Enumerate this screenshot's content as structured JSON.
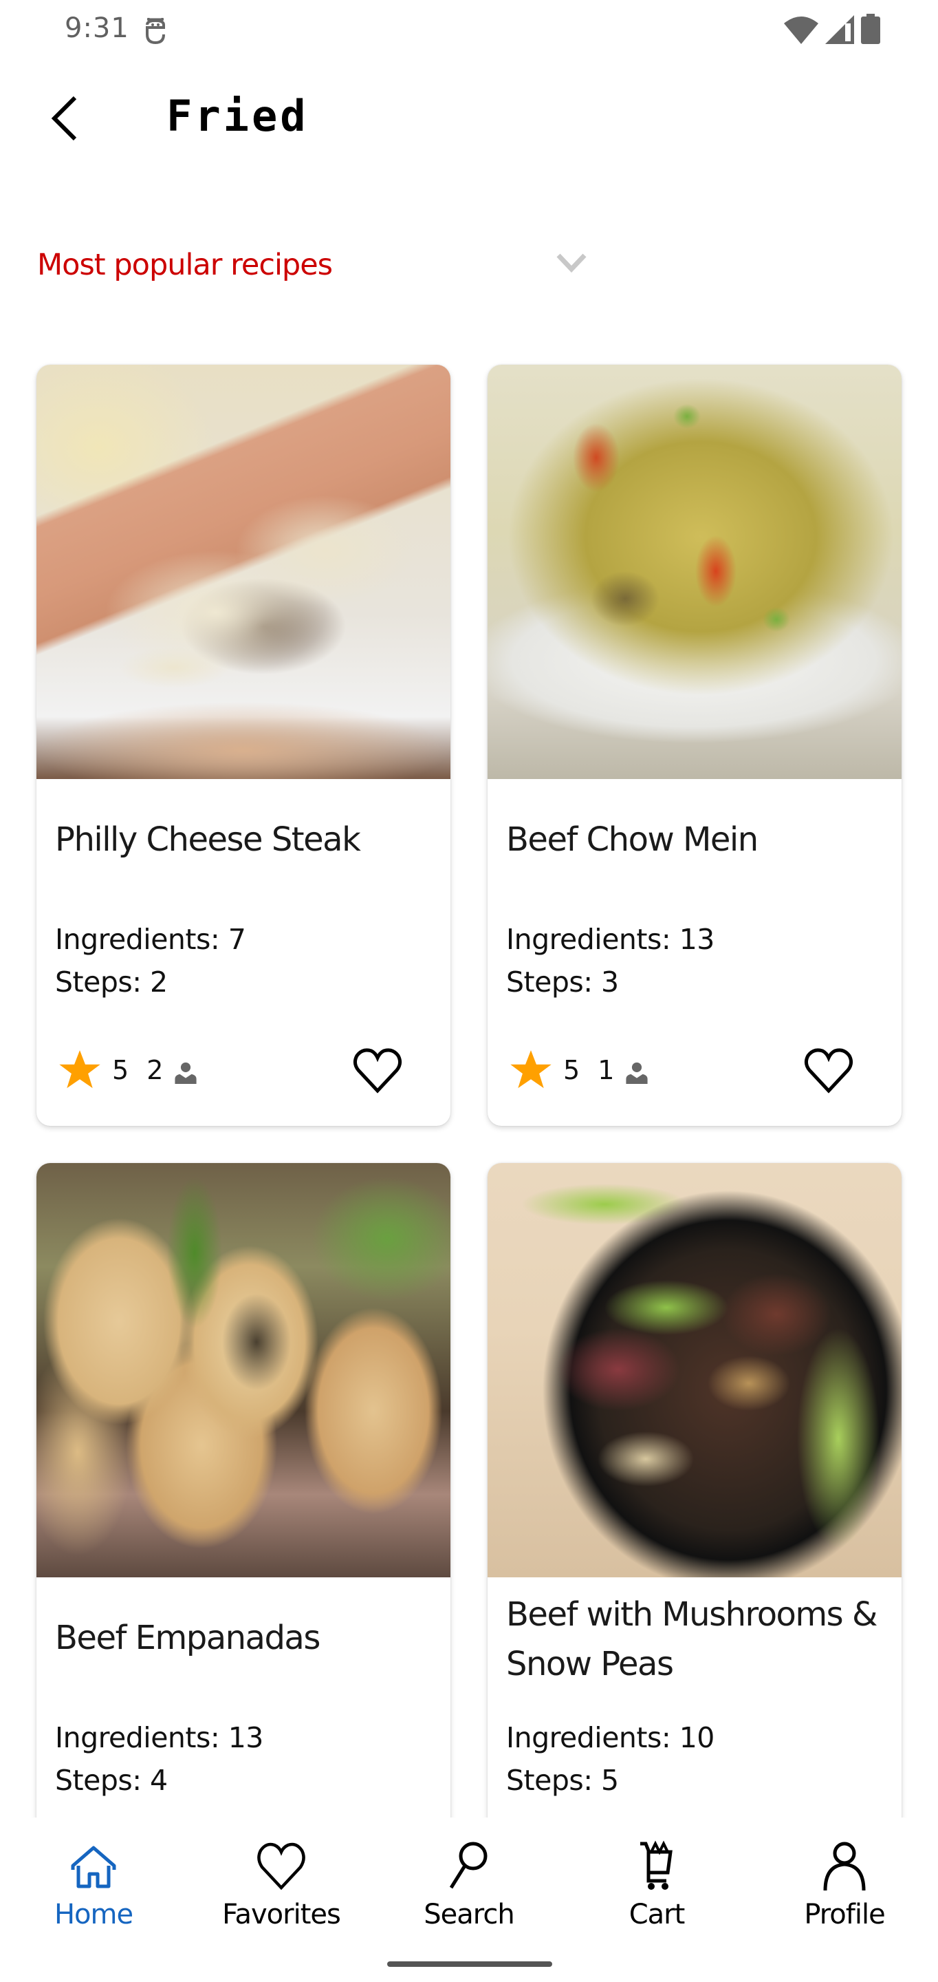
{
  "status_bar": {
    "time": "9:31",
    "icons": [
      "app-notification-icon",
      "wifi-icon",
      "cellular-signal-icon",
      "battery-icon"
    ]
  },
  "app_bar": {
    "back_icon": "chevron-left-icon",
    "title": "Fried"
  },
  "sort_dropdown": {
    "selected": "Most popular recipes",
    "icon": "chevron-down-icon"
  },
  "colors": {
    "accent_red": "#cc0000",
    "star": "#ffa000",
    "nav_active": "#1565c0"
  },
  "recipes": [
    {
      "title": "Philly Cheese Steak",
      "ingredients_label": "Ingredients: 7",
      "steps_label": "Steps: 2",
      "rating": "5",
      "reviews": "2",
      "image_alt": "Philly cheese steak sandwich"
    },
    {
      "title": "Beef Chow Mein",
      "ingredients_label": "Ingredients: 13",
      "steps_label": "Steps: 3",
      "rating": "5",
      "reviews": "1",
      "image_alt": "Beef chow mein noodles in bowl"
    },
    {
      "title": "Beef Empanadas",
      "ingredients_label": "Ingredients: 13",
      "steps_label": "Steps: 4",
      "image_alt": "Beef empanadas with parsley"
    },
    {
      "title": "Beef with Mushrooms & Snow Peas",
      "ingredients_label": "Ingredients: 10",
      "steps_label": "Steps: 5",
      "image_alt": "Beef with mushrooms and snow peas in black bowl"
    }
  ],
  "bottom_nav": {
    "items": [
      {
        "label": "Home",
        "icon": "home-icon",
        "active": true
      },
      {
        "label": "Favorites",
        "icon": "heart-icon",
        "active": false
      },
      {
        "label": "Search",
        "icon": "search-icon",
        "active": false
      },
      {
        "label": "Cart",
        "icon": "cart-icon",
        "active": false
      },
      {
        "label": "Profile",
        "icon": "person-icon",
        "active": false
      }
    ]
  }
}
